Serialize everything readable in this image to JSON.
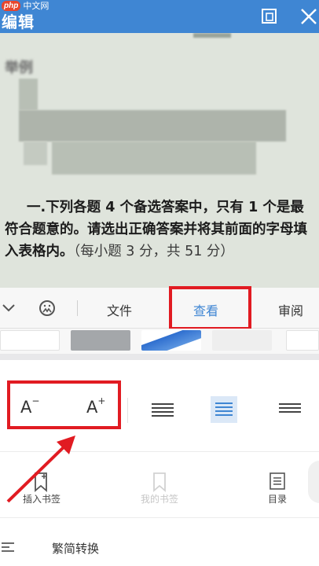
{
  "watermark": {
    "brand": "php",
    "site": "中文网"
  },
  "header": {
    "title": "编辑",
    "icons": [
      "copy-icon",
      "close-icon"
    ]
  },
  "document": {
    "heading": "举例",
    "question_intro": "一.下列各题 4 个备选答案中，只有 1 个是最符合题意的。请选出正确答案并将其前面的字母填入表格内。",
    "question_score": "（每小题 3 分，共 51 分）"
  },
  "tabs": {
    "items": [
      {
        "label": "文件"
      },
      {
        "label": "查看"
      },
      {
        "label": "审阅"
      }
    ],
    "active_index": 1,
    "left_icons": [
      "chevron-down-icon",
      "emoji-icon"
    ]
  },
  "format": {
    "decrease_font": "A",
    "increase_font": "A",
    "minus_sign": "−",
    "plus_sign": "+",
    "alignment_selected": "center"
  },
  "tools": {
    "bookmark_label": "插入书签",
    "disabled_label": "我的书签",
    "toc_label": "目录"
  },
  "rows": {
    "convert_label": "繁简转换"
  },
  "colors": {
    "header_bg": "#3f86d3",
    "accent": "#3f86d3",
    "highlight": "#e11b22"
  }
}
